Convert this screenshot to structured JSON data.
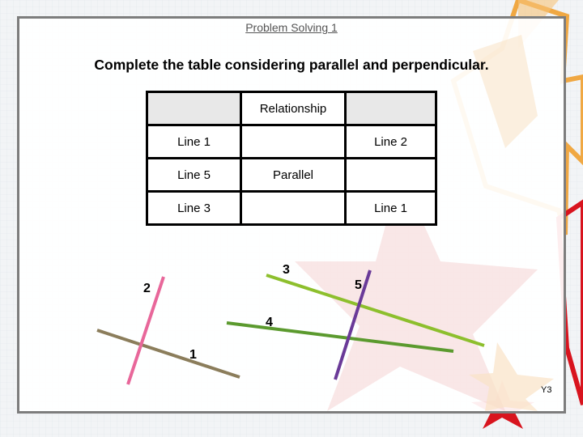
{
  "slide": {
    "title": "Problem Solving 1",
    "instruction": "Complete the table considering parallel and perpendicular.",
    "footer_code": "Y3"
  },
  "table": {
    "header": [
      "",
      "Relationship",
      ""
    ],
    "rows": [
      [
        "Line 1",
        "",
        "Line 2"
      ],
      [
        "Line 5",
        "Parallel",
        ""
      ],
      [
        "Line 3",
        "",
        "Line 1"
      ]
    ]
  },
  "diagram": {
    "lines": [
      {
        "id": "1",
        "label": "1",
        "color": "#8b7d5b"
      },
      {
        "id": "2",
        "label": "2",
        "color": "#e8679a"
      },
      {
        "id": "3",
        "label": "3",
        "color": "#8dbf2d"
      },
      {
        "id": "4",
        "label": "4",
        "color": "#5b9a2e"
      },
      {
        "id": "5",
        "label": "5",
        "color": "#6a3a98"
      }
    ]
  },
  "theme": {
    "frame_border": "#7d7d7d",
    "header_shade": "#e8e8e8",
    "accent_orange": "#f0a030",
    "accent_red": "#d8141e"
  }
}
